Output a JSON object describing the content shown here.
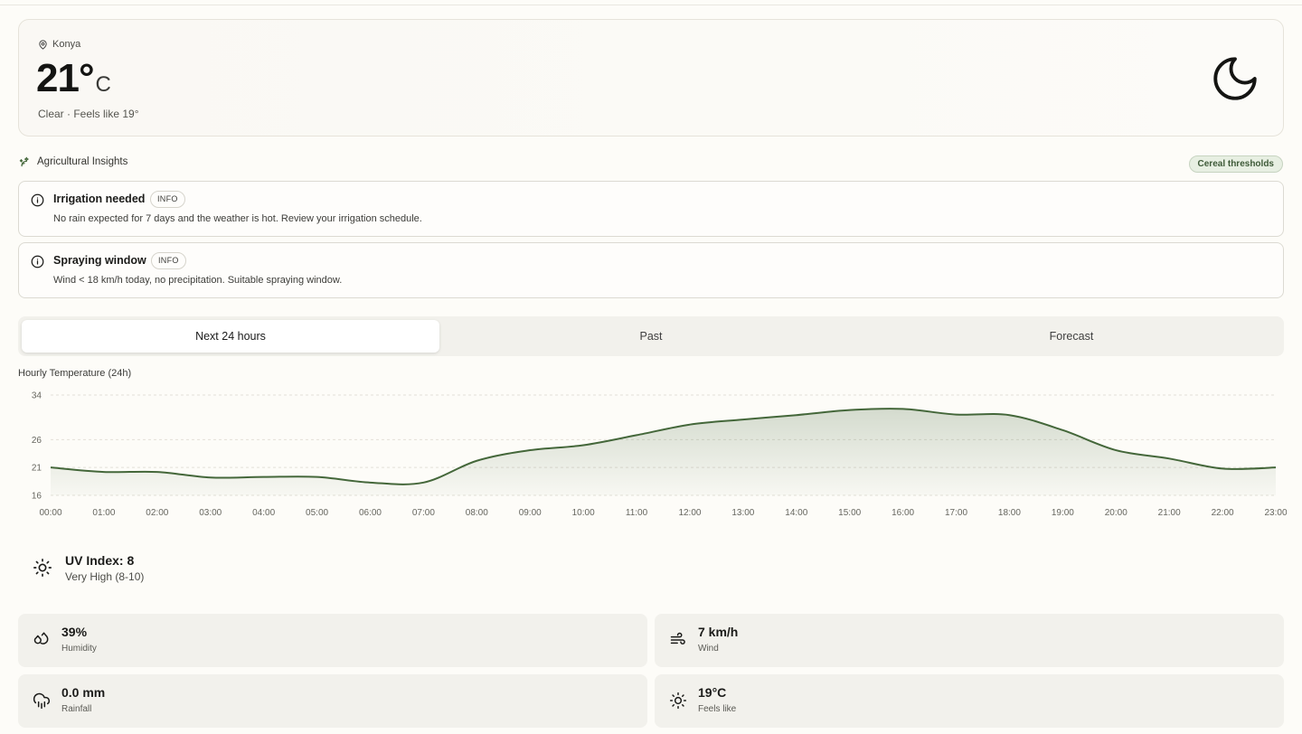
{
  "current": {
    "location": "Konya",
    "temperature": "21°",
    "unit": "C",
    "condition": "Clear  · Feels like 19°",
    "icon": "moon-icon"
  },
  "agri": {
    "title": "Agricultural Insights",
    "threshold_button": "Cereal thresholds",
    "alerts": [
      {
        "title": "Irrigation needed",
        "badge": "INFO",
        "text": "No rain expected for 7 days and the weather is hot. Review your irrigation schedule."
      },
      {
        "title": "Spraying window",
        "badge": "INFO",
        "text": "Wind < 18 km/h today, no precipitation. Suitable spraying window."
      }
    ]
  },
  "tabs": [
    {
      "label": "Next 24 hours",
      "active": true
    },
    {
      "label": "Past",
      "active": false
    },
    {
      "label": "Forecast",
      "active": false
    }
  ],
  "chart_data": {
    "type": "area",
    "title": "Hourly Temperature (24h)",
    "xlabel": "",
    "ylabel": "",
    "yticks": [
      34,
      26,
      21,
      16
    ],
    "ylim": [
      16,
      34
    ],
    "categories": [
      "00:00",
      "01:00",
      "02:00",
      "03:00",
      "04:00",
      "05:00",
      "06:00",
      "07:00",
      "08:00",
      "09:00",
      "10:00",
      "11:00",
      "12:00",
      "13:00",
      "14:00",
      "15:00",
      "16:00",
      "17:00",
      "18:00",
      "19:00",
      "20:00",
      "21:00",
      "22:00",
      "23:00"
    ],
    "series": [
      {
        "values": [
          21,
          20.2,
          20.2,
          19.2,
          19.3,
          19.3,
          18.3,
          18.3,
          22.2,
          24.1,
          25,
          26.8,
          28.7,
          29.6,
          30.4,
          31.3,
          31.5,
          30.5,
          30.4,
          27.7,
          24.1,
          22.6,
          20.8,
          21
        ]
      }
    ],
    "color": "#44673a",
    "grid": "horizontal dashed",
    "legend": "none"
  },
  "uv": {
    "value": "UV Index: 8",
    "level": "Very High (8-10)"
  },
  "stats": [
    {
      "value": "39%",
      "label": "Humidity",
      "icon": "droplets-icon"
    },
    {
      "value": "7 km/h",
      "label": "Wind",
      "icon": "wind-icon"
    },
    {
      "value": "0.0 mm",
      "label": "Rainfall",
      "icon": "cloud-rain-icon"
    },
    {
      "value": "19°C",
      "label": "Feels like",
      "icon": "sun-icon"
    }
  ]
}
